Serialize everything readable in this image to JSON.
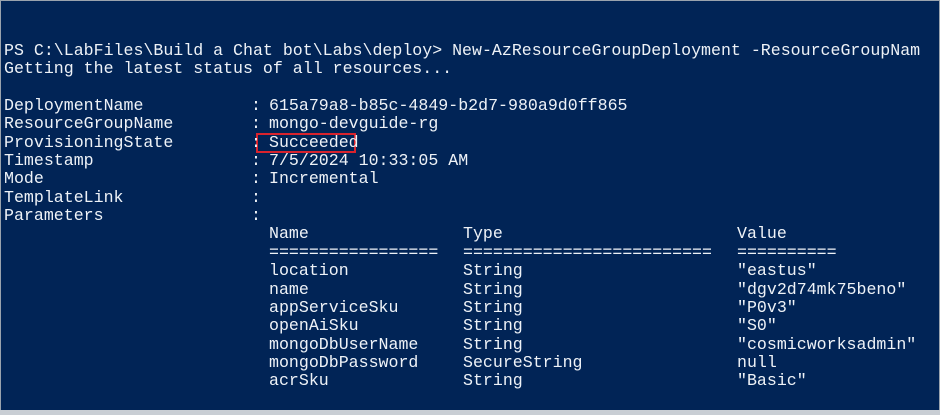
{
  "terminal": {
    "command_line": "PS C:\\LabFiles\\Build a Chat bot\\Labs\\deploy> New-AzResourceGroupDeployment -ResourceGroupNam",
    "status_line": "Getting the latest status of all resources...",
    "properties": [
      {
        "key": "DeploymentName",
        "value": "615a79a8-b85c-4849-b2d7-980a9d0ff865"
      },
      {
        "key": "ResourceGroupName",
        "value": "mongo-devguide-rg"
      },
      {
        "key": "ProvisioningState",
        "value": "Succeeded"
      },
      {
        "key": "Timestamp",
        "value": "7/5/2024 10:33:05 AM"
      },
      {
        "key": "Mode",
        "value": "Incremental"
      },
      {
        "key": "TemplateLink",
        "value": ""
      },
      {
        "key": "Parameters",
        "value": ""
      }
    ],
    "separator": ":",
    "highlight_color": "#d9232d",
    "parameters_table": {
      "headers": [
        "Name",
        "Type",
        "Value"
      ],
      "underlines": [
        "=================",
        "=========================",
        "=========="
      ],
      "rows": [
        [
          "location",
          "String",
          "\"eastus\""
        ],
        [
          "name",
          "String",
          "\"dgv2d74mk75beno\""
        ],
        [
          "appServiceSku",
          "String",
          "\"P0v3\""
        ],
        [
          "openAiSku",
          "String",
          "\"S0\""
        ],
        [
          "mongoDbUserName",
          "String",
          "\"cosmicworksadmin\""
        ],
        [
          "mongoDbPassword",
          "SecureString",
          "null"
        ],
        [
          "acrSku",
          "String",
          "\"Basic\""
        ]
      ]
    }
  }
}
